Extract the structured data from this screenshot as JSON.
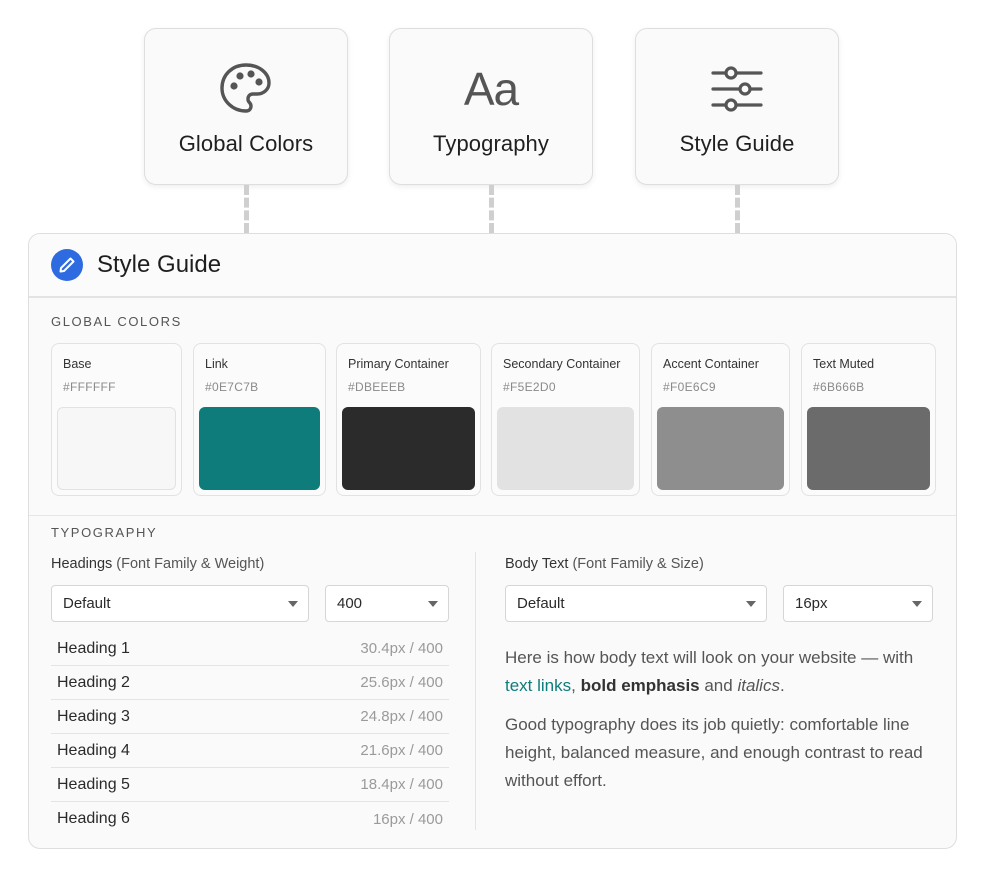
{
  "cards": [
    {
      "title": "Global Colors",
      "icon": "palette-icon"
    },
    {
      "title": "Typography",
      "icon": "font-aa-icon",
      "glyph": "Aa"
    },
    {
      "title": "Style Guide",
      "icon": "sliders-icon"
    }
  ],
  "panel": {
    "title": "Style Guide",
    "icon": "pencil-icon",
    "accent": "#2F6BE0"
  },
  "global_colors": {
    "label": "GLOBAL COLORS",
    "swatches": [
      {
        "name": "Base",
        "hex": "#FFFFFF",
        "fill": "#F7F7F7"
      },
      {
        "name": "Link",
        "hex": "#0E7C7B",
        "fill": "#0E7C7B"
      },
      {
        "name": "Primary Container",
        "hex": "#DBEEEB",
        "fill": "#2B2B2B"
      },
      {
        "name": "Secondary Container",
        "hex": "#F5E2D0",
        "fill": "#E2E2E2"
      },
      {
        "name": "Accent Container",
        "hex": "#F0E6C9",
        "fill": "#8E8E8E"
      },
      {
        "name": "Text Muted",
        "hex": "#6B666B",
        "fill": "#6B6B6B"
      }
    ]
  },
  "typography": {
    "label": "TYPOGRAPHY",
    "headings": {
      "label": "Headings",
      "sub_label": "(Font Family & Weight)",
      "family": "Default",
      "weight": "400",
      "rows": [
        {
          "name": "Heading 1",
          "meta": "30.4px / 400"
        },
        {
          "name": "Heading 2",
          "meta": "25.6px / 400"
        },
        {
          "name": "Heading 3",
          "meta": "24.8px / 400"
        },
        {
          "name": "Heading 4",
          "meta": "21.6px / 400"
        },
        {
          "name": "Heading 5",
          "meta": "18.4px / 400"
        },
        {
          "name": "Heading 6",
          "meta": "16px / 400"
        }
      ]
    },
    "body": {
      "label": "Body Text",
      "sub_label": "(Font Family & Size)",
      "family": "Default",
      "size": "16px",
      "p1_start": "Here is how body text will look on your website — with ",
      "p1_link": "text links",
      "p1_comma": ", ",
      "p1_bold": "bold emphasis",
      "p1_and": " and ",
      "p1_italic": "italics",
      "p1_end": ".",
      "p2": "Good typography does its job quietly: comfortable line height, balanced measure, and enough contrast to read without effort."
    }
  }
}
